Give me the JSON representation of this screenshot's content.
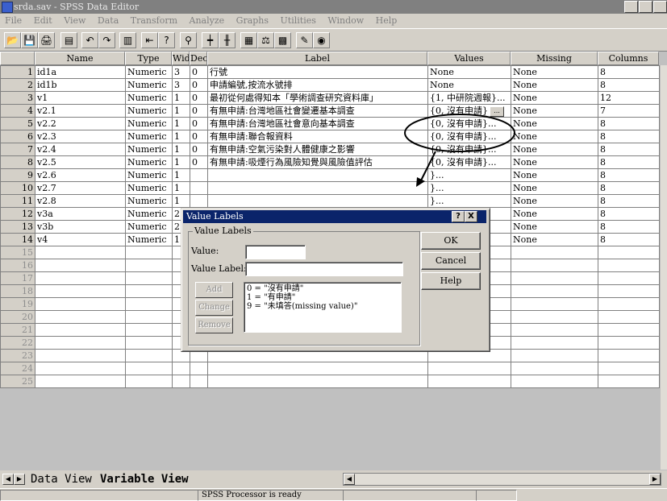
{
  "window": {
    "title": "srda.sav - SPSS Data Editor",
    "controls": [
      "_",
      "🗗",
      "x"
    ]
  },
  "menu": [
    "File",
    "Edit",
    "View",
    "Data",
    "Transform",
    "Analyze",
    "Graphs",
    "Utilities",
    "Window",
    "Help"
  ],
  "toolbar_icons": [
    "open-icon",
    "save-icon",
    "print-icon",
    "dialog-recall-icon",
    "undo-icon",
    "redo-icon",
    "goto-chart-icon",
    "goto-case-icon",
    "variables-icon",
    "find-icon",
    "insert-cases-icon",
    "insert-variable-icon",
    "split-file-icon",
    "weight-cases-icon",
    "select-cases-icon",
    "value-labels-icon",
    "use-sets-icon"
  ],
  "columns": [
    "Name",
    "Type",
    "Wid",
    "Dec",
    "Label",
    "Values",
    "Missing",
    "Columns"
  ],
  "rows": [
    {
      "n": "1",
      "name": "id1a",
      "type": "Numeric",
      "wid": "3",
      "dec": "0",
      "label": "行號",
      "values": "None",
      "missing": "None",
      "columns": "8"
    },
    {
      "n": "2",
      "name": "id1b",
      "type": "Numeric",
      "wid": "3",
      "dec": "0",
      "label": "申請編號,按流水號排",
      "values": "None",
      "missing": "None",
      "columns": "8"
    },
    {
      "n": "3",
      "name": "v1",
      "type": "Numeric",
      "wid": "1",
      "dec": "0",
      "label": "最初從何處得知本「學術調查研究資料庫」",
      "values": "{1, 中研院週報}...",
      "missing": "None",
      "columns": "12"
    },
    {
      "n": "4",
      "name": "v2.1",
      "type": "Numeric",
      "wid": "1",
      "dec": "0",
      "label": "有無申請:台灣地區社會變遷基本調查",
      "values": "{0, 沒有申請}",
      "missing": "None",
      "columns": "7"
    },
    {
      "n": "5",
      "name": "v2.2",
      "type": "Numeric",
      "wid": "1",
      "dec": "0",
      "label": "有無申請:台灣地區社會意向基本調查",
      "values": "{0, 沒有申請}...",
      "missing": "None",
      "columns": "8"
    },
    {
      "n": "6",
      "name": "v2.3",
      "type": "Numeric",
      "wid": "1",
      "dec": "0",
      "label": "有無申請:聯合報資料",
      "values": "{0, 沒有申請}...",
      "missing": "None",
      "columns": "8"
    },
    {
      "n": "7",
      "name": "v2.4",
      "type": "Numeric",
      "wid": "1",
      "dec": "0",
      "label": "有無申請:空氣污染對人體健康之影響",
      "values": "{0, 沒有申請}...",
      "missing": "None",
      "columns": "8"
    },
    {
      "n": "8",
      "name": "v2.5",
      "type": "Numeric",
      "wid": "1",
      "dec": "0",
      "label": "有無申請:吸煙行為風險知覺與風險值評估",
      "values": "{0, 沒有申請}...",
      "missing": "None",
      "columns": "8"
    },
    {
      "n": "9",
      "name": "v2.6",
      "type": "Numeric",
      "wid": "1",
      "dec": "",
      "label": "",
      "values": "}...",
      "missing": "None",
      "columns": "8"
    },
    {
      "n": "10",
      "name": "v2.7",
      "type": "Numeric",
      "wid": "1",
      "dec": "",
      "label": "",
      "values": "}...",
      "missing": "None",
      "columns": "8"
    },
    {
      "n": "11",
      "name": "v2.8",
      "type": "Numeric",
      "wid": "1",
      "dec": "",
      "label": "",
      "values": "}...",
      "missing": "None",
      "columns": "8"
    },
    {
      "n": "12",
      "name": "v3a",
      "type": "Numeric",
      "wid": "2",
      "dec": "",
      "label": "",
      "values": "",
      "missing": "None",
      "columns": "8"
    },
    {
      "n": "13",
      "name": "v3b",
      "type": "Numeric",
      "wid": "2",
      "dec": "",
      "label": "",
      "values": "",
      "missing": "None",
      "columns": "8"
    },
    {
      "n": "14",
      "name": "v4",
      "type": "Numeric",
      "wid": "1",
      "dec": "",
      "label": "",
      "values": "",
      "missing": "None",
      "columns": "8"
    },
    {
      "n": "15"
    },
    {
      "n": "16"
    },
    {
      "n": "17"
    },
    {
      "n": "18"
    },
    {
      "n": "19"
    },
    {
      "n": "20"
    },
    {
      "n": "21"
    },
    {
      "n": "22"
    },
    {
      "n": "23"
    },
    {
      "n": "24"
    },
    {
      "n": "25"
    }
  ],
  "tabs": {
    "data_view": "Data View",
    "variable_view": "Variable View"
  },
  "status": "SPSS Processor  is ready",
  "dialog": {
    "title": "Value Labels",
    "title_buttons": [
      "?",
      "X"
    ],
    "group_label": "Value Labels",
    "value_label": "Value:",
    "value_label_label": "Value Label:",
    "value_input": "",
    "value_label_input": "",
    "add": "Add",
    "change": "Change",
    "remove": "Remove",
    "ok": "OK",
    "cancel": "Cancel",
    "help": "Help",
    "entries": [
      "0 = \"沒有申請\"",
      "1 = \"有申請\"",
      "9 = \"未填答(missing value)\""
    ]
  }
}
